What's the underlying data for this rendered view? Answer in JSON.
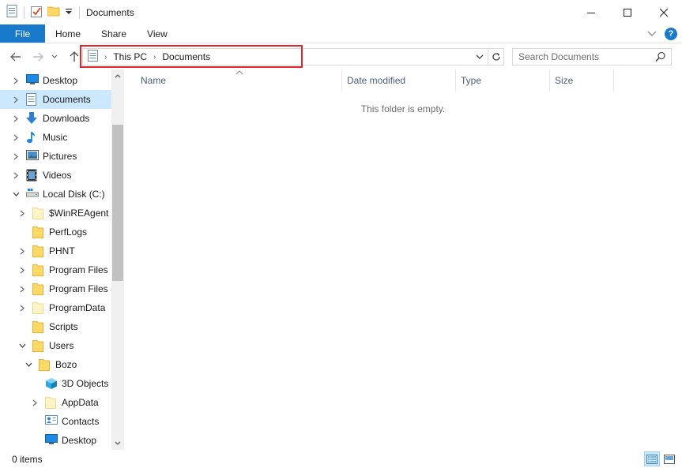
{
  "window": {
    "title": "Documents",
    "buttons": {
      "minimize": "—",
      "maximize": "☐",
      "close": "✕"
    }
  },
  "ribbon": {
    "tabs": [
      "File",
      "Home",
      "Share",
      "View"
    ]
  },
  "address": {
    "crumbs": [
      "This PC",
      "Documents"
    ]
  },
  "search": {
    "placeholder": "Search Documents"
  },
  "nav": {
    "items": [
      {
        "label": "Desktop",
        "icon": "desktop-icon",
        "indent": 0,
        "expander": "collapsed"
      },
      {
        "label": "Documents",
        "icon": "documents-icon",
        "indent": 0,
        "expander": "collapsed",
        "selected": true
      },
      {
        "label": "Downloads",
        "icon": "download-icon",
        "indent": 0,
        "expander": "collapsed"
      },
      {
        "label": "Music",
        "icon": "music-icon",
        "indent": 0,
        "expander": "collapsed"
      },
      {
        "label": "Pictures",
        "icon": "pictures-icon",
        "indent": 0,
        "expander": "collapsed"
      },
      {
        "label": "Videos",
        "icon": "videos-icon",
        "indent": 0,
        "expander": "collapsed"
      },
      {
        "label": "Local Disk (C:)",
        "icon": "drive-icon",
        "indent": 0,
        "expander": "expanded"
      },
      {
        "label": "$WinREAgent",
        "icon": "folder-pale-icon",
        "indent": 1,
        "expander": "collapsed"
      },
      {
        "label": "PerfLogs",
        "icon": "folder-icon",
        "indent": 1,
        "expander": "none"
      },
      {
        "label": "PHNT",
        "icon": "folder-icon",
        "indent": 1,
        "expander": "collapsed"
      },
      {
        "label": "Program Files",
        "icon": "folder-icon",
        "indent": 1,
        "expander": "collapsed"
      },
      {
        "label": "Program Files (",
        "icon": "folder-icon",
        "indent": 1,
        "expander": "collapsed"
      },
      {
        "label": "ProgramData",
        "icon": "folder-pale-icon",
        "indent": 1,
        "expander": "collapsed"
      },
      {
        "label": "Scripts",
        "icon": "folder-icon",
        "indent": 1,
        "expander": "none"
      },
      {
        "label": "Users",
        "icon": "folder-icon",
        "indent": 1,
        "expander": "expanded"
      },
      {
        "label": "Bozo",
        "icon": "folder-icon",
        "indent": 2,
        "expander": "expanded"
      },
      {
        "label": "3D Objects",
        "icon": "3d-objects-icon",
        "indent": 3,
        "expander": "none"
      },
      {
        "label": "AppData",
        "icon": "folder-pale-icon",
        "indent": 3,
        "expander": "collapsed"
      },
      {
        "label": "Contacts",
        "icon": "contacts-icon",
        "indent": 3,
        "expander": "none"
      },
      {
        "label": "Desktop",
        "icon": "desktop-icon",
        "indent": 3,
        "expander": "none"
      }
    ]
  },
  "columns": [
    "Name",
    "Date modified",
    "Type",
    "Size"
  ],
  "content": {
    "empty_message": "This folder is empty."
  },
  "status": {
    "item_count": "0 items"
  },
  "colors": {
    "accent": "#1979ca",
    "selection": "#cce8ff",
    "highlight_box": "#e0262b",
    "folder": "#ffd865"
  }
}
